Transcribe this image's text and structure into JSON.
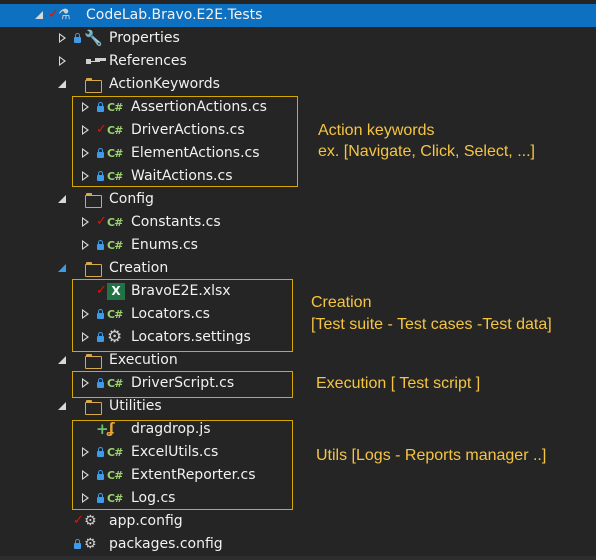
{
  "project": {
    "label": "CodeLab.Bravo.E2E.Tests",
    "status": "checked-out",
    "icon": "test-project-flask-icon"
  },
  "items": [
    {
      "label": "Properties",
      "icon": "wrench-icon",
      "status": "locked"
    },
    {
      "label": "References",
      "icon": "references-icon",
      "status": "none"
    },
    {
      "label": "ActionKeywords",
      "icon": "folder-icon",
      "status": "none"
    },
    {
      "label": "AssertionActions.cs",
      "icon": "csharp-file-icon",
      "status": "locked"
    },
    {
      "label": "DriverActions.cs",
      "icon": "csharp-file-icon",
      "status": "checked-out"
    },
    {
      "label": "ElementActions.cs",
      "icon": "csharp-file-icon",
      "status": "locked"
    },
    {
      "label": "WaitActions.cs",
      "icon": "csharp-file-icon",
      "status": "locked"
    },
    {
      "label": "Config",
      "icon": "folder-icon",
      "status": "none"
    },
    {
      "label": "Constants.cs",
      "icon": "csharp-file-icon",
      "status": "checked-out"
    },
    {
      "label": "Enums.cs",
      "icon": "csharp-file-icon",
      "status": "locked"
    },
    {
      "label": "Creation",
      "icon": "folder-icon",
      "status": "none"
    },
    {
      "label": "BravoE2E.xlsx",
      "icon": "excel-file-icon",
      "status": "checked-out"
    },
    {
      "label": "Locators.cs",
      "icon": "csharp-file-icon",
      "status": "locked"
    },
    {
      "label": "Locators.settings",
      "icon": "settings-gear-icon",
      "status": "locked"
    },
    {
      "label": "Execution",
      "icon": "folder-icon",
      "status": "none"
    },
    {
      "label": "DriverScript.cs",
      "icon": "csharp-file-icon",
      "status": "locked"
    },
    {
      "label": "Utilities",
      "icon": "folder-icon",
      "status": "none"
    },
    {
      "label": "dragdrop.js",
      "icon": "javascript-file-icon",
      "status": "added"
    },
    {
      "label": "ExcelUtils.cs",
      "icon": "csharp-file-icon",
      "status": "locked"
    },
    {
      "label": "ExtentReporter.cs",
      "icon": "csharp-file-icon",
      "status": "locked"
    },
    {
      "label": "Log.cs",
      "icon": "csharp-file-icon",
      "status": "locked"
    },
    {
      "label": "app.config",
      "icon": "config-file-icon",
      "status": "checked-out"
    },
    {
      "label": "packages.config",
      "icon": "config-file-icon",
      "status": "locked"
    }
  ],
  "annotations": {
    "action_keywords": {
      "line1": "Action keywords",
      "line2": "ex. [Navigate, Click, Select, ...]"
    },
    "creation": {
      "line1": "Creation",
      "line2": "[Test suite - Test cases -Test data]"
    },
    "execution": {
      "line1": "Execution [ Test script ]"
    },
    "utils": {
      "line1": "Utils [Logs - Reports manager ..]"
    }
  },
  "colors": {
    "background": "#252526",
    "selection": "#0e70c0",
    "annotation": "#f5c542",
    "csharp": "#9bd26e",
    "folder": "#d7a94b",
    "lock": "#3d9be9",
    "checkmark": "#e51400"
  }
}
